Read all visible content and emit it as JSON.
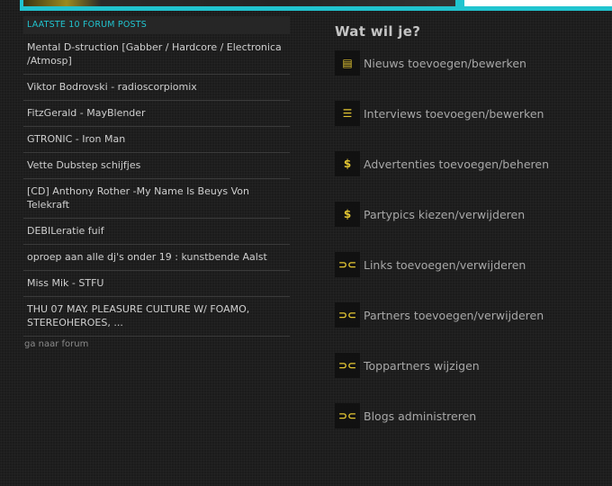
{
  "forum": {
    "header": "LAATSTE 10 FORUM POSTS",
    "posts": [
      "Mental D-struction [Gabber / Hardcore / Electronica /Atmosp]",
      "Viktor Bodrovski - radioscorpiomix",
      "FitzGerald - MayBlender",
      "GTRONIC - Iron Man",
      "Vette Dubstep schijfjes",
      "[CD] Anthony Rother -My Name Is Beuys Von Telekraft",
      "DEBILeratie fuif",
      "oproep aan alle dj's onder 19 : kunstbende Aalst",
      "Miss Mik - STFU",
      "THU 07 MAY. PLEASURE CULTURE W/ FOAMO, STEREOHEROES, ..."
    ],
    "more_link": "ga naar forum"
  },
  "actions": {
    "title": "Wat wil je?",
    "items": [
      {
        "label": "Nieuws toevoegen/bewerken",
        "icon": "document-icon",
        "glyph": "▤"
      },
      {
        "label": "Interviews toevoegen/bewerken",
        "icon": "speech-bubble-icon",
        "glyph": "☰"
      },
      {
        "label": "Advertenties toevoegen/beheren",
        "icon": "dollar-icon",
        "glyph": "$"
      },
      {
        "label": "Partypics kiezen/verwijderen",
        "icon": "dollar-icon",
        "glyph": "$"
      },
      {
        "label": "Links toevoegen/verwijderen",
        "icon": "link-icon",
        "glyph": "⊃⊂"
      },
      {
        "label": "Partners toevoegen/verwijderen",
        "icon": "link-icon",
        "glyph": "⊃⊂"
      },
      {
        "label": "Toppartners wijzigen",
        "icon": "link-icon",
        "glyph": "⊃⊂"
      },
      {
        "label": "Blogs administreren",
        "icon": "link-icon",
        "glyph": "⊃⊂"
      }
    ]
  },
  "colors": {
    "accent": "#21c4cf",
    "icon": "#e2c532",
    "background": "#1b1b1b"
  }
}
